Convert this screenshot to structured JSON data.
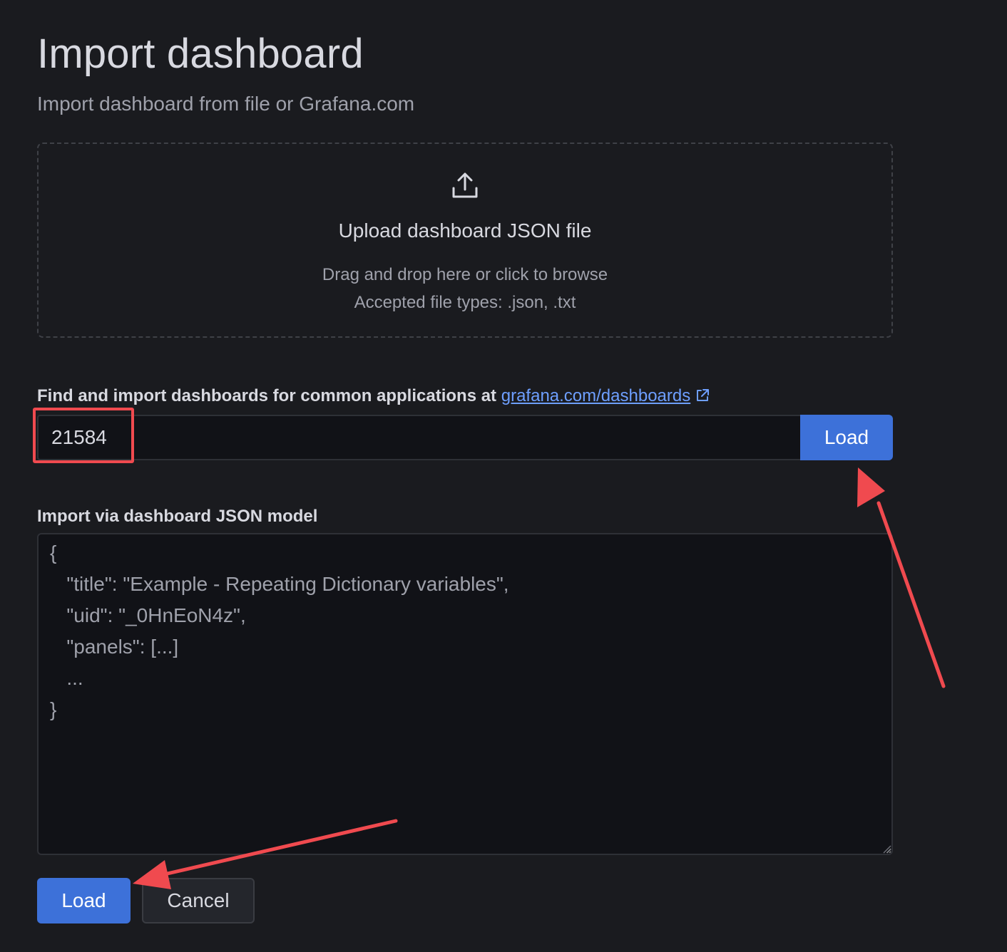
{
  "header": {
    "title": "Import dashboard",
    "subtitle": "Import dashboard from file or Grafana.com"
  },
  "upload": {
    "icon": "upload-icon",
    "title": "Upload dashboard JSON file",
    "hint_line1": "Drag and drop here or click to browse",
    "hint_line2": "Accepted file types: .json, .txt"
  },
  "grafana_com": {
    "label_prefix": "Find and import dashboards for common applications at",
    "link_text": "grafana.com/dashboards",
    "link_icon": "external-link-icon",
    "input_value": "21584",
    "load_label": "Load"
  },
  "json_model": {
    "label": "Import via dashboard JSON model",
    "placeholder_lines": [
      "{",
      "   \"title\": \"Example - Repeating Dictionary variables\",",
      "   \"uid\": \"_0HnEoN4z\",",
      "   \"panels\": [...]",
      "   ...",
      "}"
    ]
  },
  "footer": {
    "load_label": "Load",
    "cancel_label": "Cancel"
  },
  "colors": {
    "background": "#1a1b1f",
    "primary": "#3d71d9",
    "link": "#6e9fff",
    "annotation": "#f04a4f"
  }
}
